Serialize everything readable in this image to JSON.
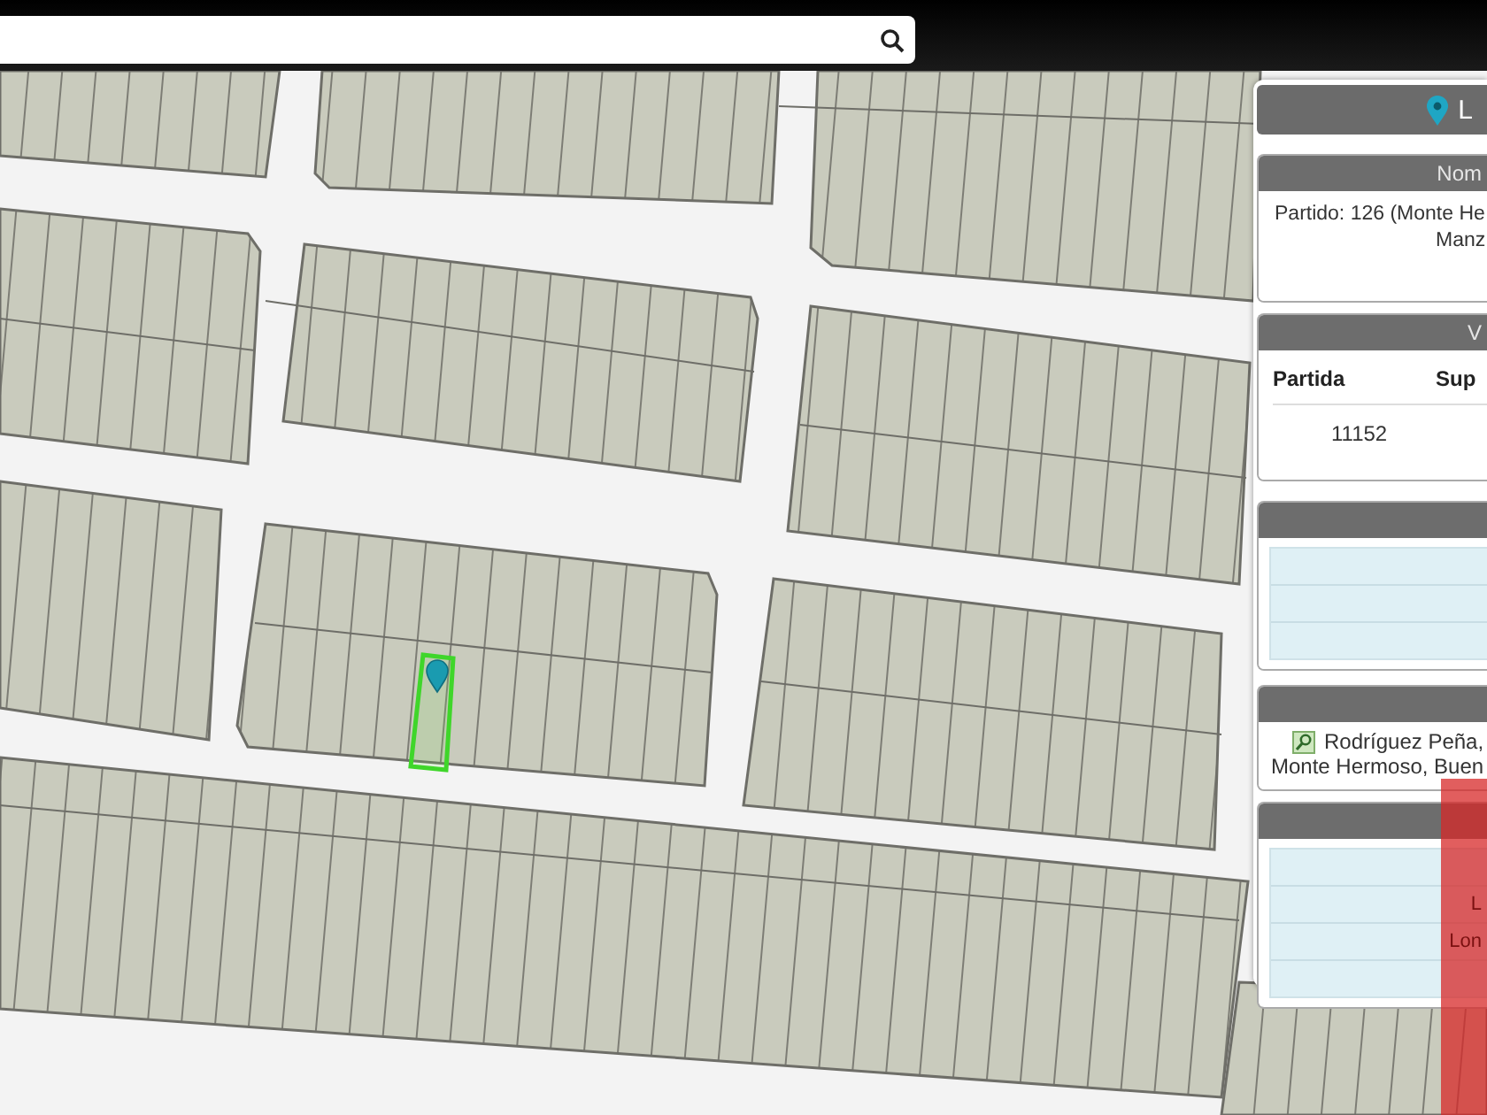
{
  "panel": {
    "title": "L",
    "sections": [
      {
        "kind": "text",
        "header": "Nom",
        "lines": [
          "Partido: 126 (Monte He",
          "Manz"
        ]
      },
      {
        "kind": "table",
        "header": "V",
        "columns": [
          "Partida",
          "Sup"
        ],
        "rows": [
          [
            "11152"
          ]
        ]
      },
      {
        "kind": "striped"
      },
      {
        "kind": "address",
        "lines": [
          "Rodríguez Peña,",
          "Monte Hermoso, Buen"
        ]
      },
      {
        "kind": "striped",
        "lines": [
          "L",
          "Lon"
        ]
      }
    ]
  }
}
